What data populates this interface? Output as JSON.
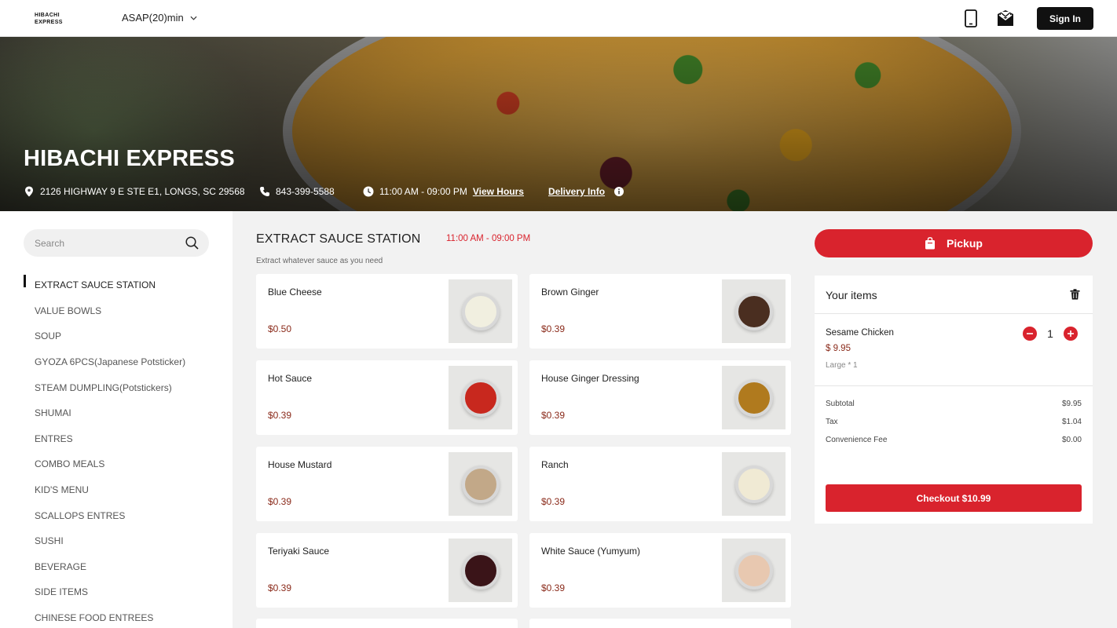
{
  "header": {
    "logo_line1": "HIBACHI",
    "logo_line2": "EXPRESS",
    "time_select": "ASAP(20)min",
    "signin_label": "Sign In"
  },
  "hero": {
    "title": "HIBACHI EXPRESS",
    "address": "2126 HIGHWAY 9 E STE E1, LONGS, SC 29568",
    "phone": "843-399-5588",
    "hours": "11:00 AM - 09:00 PM",
    "view_hours": "View Hours",
    "delivery_info": "Delivery Info"
  },
  "sidebar": {
    "search_placeholder": "Search",
    "categories": [
      "EXTRACT SAUCE STATION",
      "VALUE BOWLS",
      "SOUP",
      "GYOZA 6PCS(Japanese Potsticker)",
      "STEAM DUMPLING(Potstickers)",
      "SHUMAI",
      "ENTRES",
      "COMBO MEALS",
      "KID'S MENU",
      "SCALLOPS ENTRES",
      "SUSHI",
      "BEVERAGE",
      "SIDE ITEMS",
      "CHINESE FOOD ENTREES"
    ]
  },
  "section": {
    "title": "EXTRACT SAUCE STATION",
    "hours": "11:00 AM - 09:00 PM",
    "description": "Extract whatever sauce as you need"
  },
  "items": [
    {
      "name": "Blue Cheese",
      "price": "$0.50",
      "color": "#f1efe0"
    },
    {
      "name": "Brown Ginger",
      "price": "$0.39",
      "color": "#4a2e20"
    },
    {
      "name": "Hot Sauce",
      "price": "$0.39",
      "color": "#c8281e"
    },
    {
      "name": "House Ginger Dressing",
      "price": "$0.39",
      "color": "#b07a1e"
    },
    {
      "name": "House Mustard",
      "price": "$0.39",
      "color": "#c2a888"
    },
    {
      "name": "Ranch",
      "price": "$0.39",
      "color": "#f0ead4"
    },
    {
      "name": "Teriyaki Sauce",
      "price": "$0.39",
      "color": "#3a1418"
    },
    {
      "name": "White Sauce (Yumyum)",
      "price": "$0.39",
      "color": "#e8c8b0"
    }
  ],
  "cart": {
    "pickup_label": "Pickup",
    "title": "Your items",
    "item_name": "Sesame Chicken",
    "item_price": "$ 9.95",
    "item_option": "Large * 1",
    "quantity": "1",
    "subtotal_label": "Subtotal",
    "subtotal": "$9.95",
    "tax_label": "Tax",
    "tax": "$1.04",
    "fee_label": "Convenience Fee",
    "fee": "$0.00",
    "checkout_label": "Checkout $10.99"
  },
  "colors": {
    "accent": "#d9232d",
    "price": "#8a2a1a"
  }
}
